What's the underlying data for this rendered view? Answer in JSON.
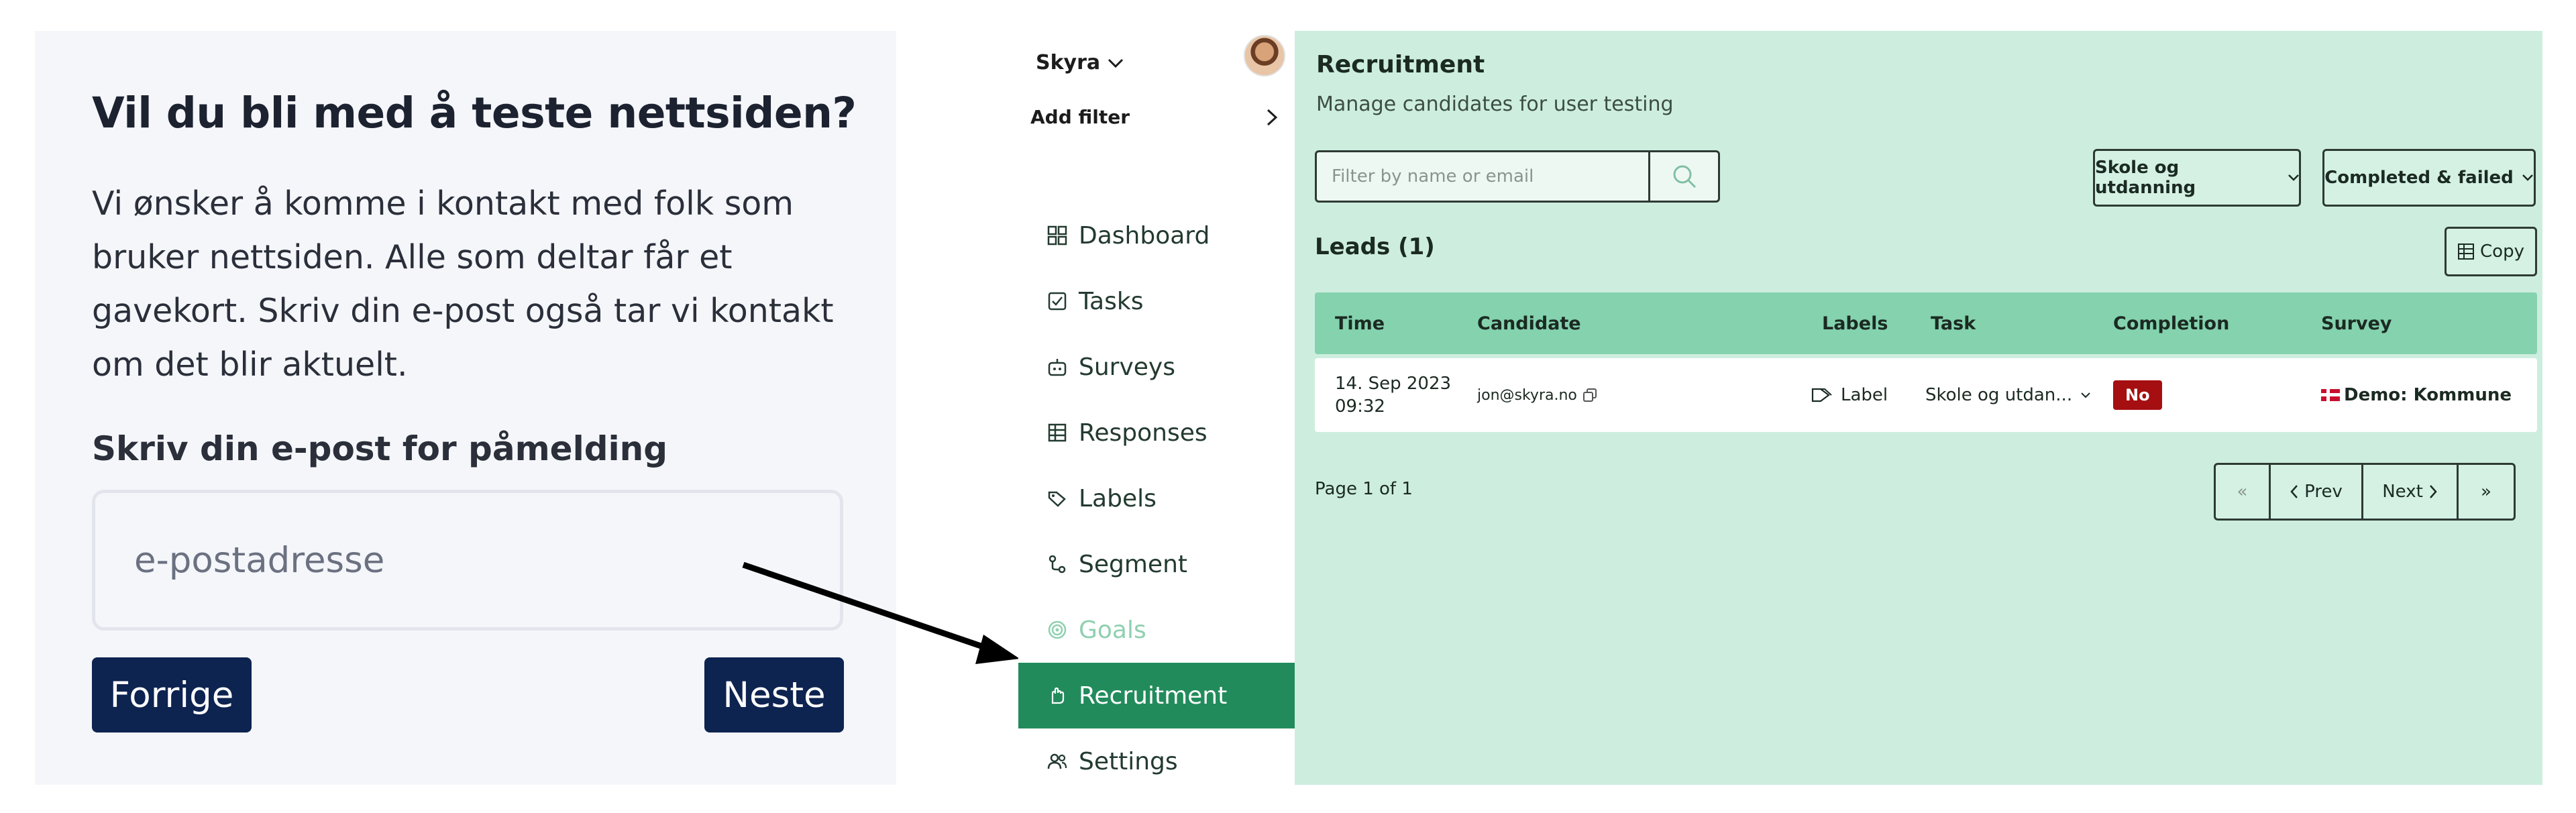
{
  "survey": {
    "title": "Vil du bli med å teste nettsiden?",
    "body": "Vi ønsker å komme i kontakt med folk som bruker nettsiden. Alle som deltar får et gavekort. Skriv din e-post også tar vi kontakt om det blir aktuelt.",
    "email_label": "Skriv din e-post for påmelding",
    "email_placeholder": "e-postadresse",
    "prev_label": "Forrige",
    "next_label": "Neste"
  },
  "sidebar": {
    "workspace": "Skyra",
    "add_filter": "Add filter",
    "items": [
      {
        "label": "Dashboard",
        "icon": "dashboard-icon"
      },
      {
        "label": "Tasks",
        "icon": "tasks-icon"
      },
      {
        "label": "Surveys",
        "icon": "surveys-icon"
      },
      {
        "label": "Responses",
        "icon": "responses-icon"
      },
      {
        "label": "Labels",
        "icon": "labels-icon"
      },
      {
        "label": "Segment",
        "icon": "segment-icon"
      },
      {
        "label": "Goals",
        "icon": "goals-icon"
      },
      {
        "label": "Recruitment",
        "icon": "recruitment-icon"
      },
      {
        "label": "Settings",
        "icon": "settings-icon"
      }
    ]
  },
  "main": {
    "title": "Recruitment",
    "subtitle": "Manage candidates for user testing",
    "search_placeholder": "Filter by name or email",
    "task_filter": "Skole og utdanning",
    "status_filter": "Completed & failed",
    "leads_title": "Leads (1)",
    "copy_label": "Copy",
    "columns": [
      "Time",
      "Candidate",
      "Labels",
      "Task",
      "Completion",
      "Survey"
    ],
    "rows": [
      {
        "date": "14. Sep 2023",
        "time": "09:32",
        "candidate": "jon@skyra.no",
        "label": "Label",
        "task": "Skole og utdan...",
        "completion": "No",
        "survey": "Demo: Kommune"
      }
    ],
    "page_info": "Page 1 of 1",
    "pager": {
      "first": "«",
      "prev": "Prev",
      "next": "Next",
      "last": "»"
    }
  },
  "colors": {
    "survey_button": "#0d2350",
    "sidebar_active": "#228b5c",
    "main_bg": "#cdeedf",
    "table_header": "#84d2ae",
    "badge_no": "#a50f12"
  }
}
